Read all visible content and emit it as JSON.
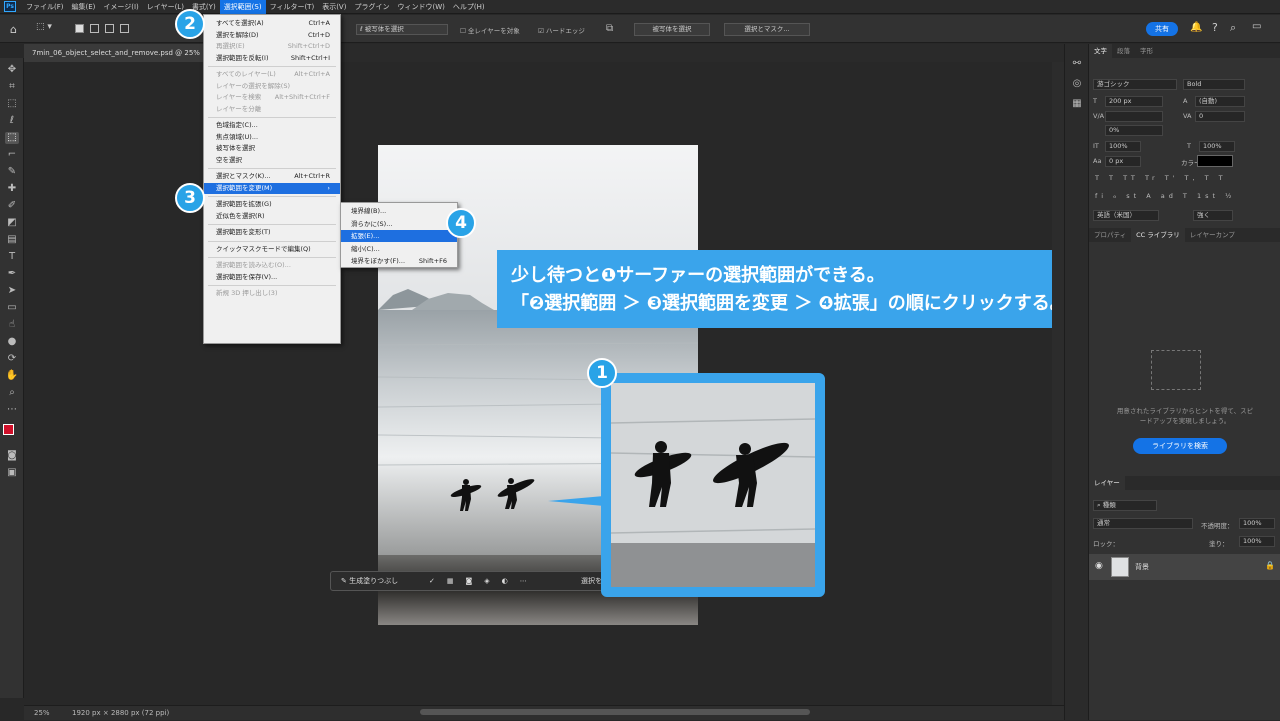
{
  "app": {
    "logo": "Ps"
  },
  "menubar": [
    {
      "label": "ファイル(F)"
    },
    {
      "label": "編集(E)"
    },
    {
      "label": "イメージ(I)"
    },
    {
      "label": "レイヤー(L)"
    },
    {
      "label": "書式(Y)"
    },
    {
      "label": "選択範囲(S)",
      "active": true
    },
    {
      "label": "フィルター(T)"
    },
    {
      "label": "表示(V)"
    },
    {
      "label": "プラグイン"
    },
    {
      "label": "ウィンドウ(W)"
    },
    {
      "label": "ヘルプ(H)"
    }
  ],
  "options": {
    "subject_tool": "被写体を選択",
    "sample_all": "全レイヤーを対象",
    "hard_edge": "ハードエッジ",
    "select_subject": "被写体を選択",
    "select_mask": "選択とマスク...",
    "share": "共有"
  },
  "document": {
    "tab_title": "7min_06_object_select_and_remove.psd @ 25%",
    "zoom": "25%",
    "info": "1920 px × 2880 px (72 ppi)"
  },
  "select_menu": [
    {
      "label": "すべてを選択(A)",
      "shortcut": "Ctrl+A"
    },
    {
      "label": "選択を解除(D)",
      "shortcut": "Ctrl+D"
    },
    {
      "label": "再選択(E)",
      "shortcut": "Shift+Ctrl+D",
      "disabled": true
    },
    {
      "label": "選択範囲を反転(I)",
      "shortcut": "Shift+Ctrl+I"
    },
    {
      "sep": true
    },
    {
      "label": "すべてのレイヤー(L)",
      "shortcut": "Alt+Ctrl+A",
      "disabled": true
    },
    {
      "label": "レイヤーの選択を解除(S)",
      "shortcut": "",
      "disabled": true
    },
    {
      "label": "レイヤーを検索",
      "shortcut": "Alt+Shift+Ctrl+F",
      "disabled": true
    },
    {
      "label": "レイヤーを分離",
      "shortcut": "",
      "disabled": true
    },
    {
      "sep": true
    },
    {
      "label": "色域指定(C)...",
      "shortcut": ""
    },
    {
      "label": "焦点領域(U)...",
      "shortcut": ""
    },
    {
      "label": "被写体を選択",
      "shortcut": ""
    },
    {
      "label": "空を選択",
      "shortcut": ""
    },
    {
      "sep": true
    },
    {
      "label": "選択とマスク(K)...",
      "shortcut": "Alt+Ctrl+R"
    },
    {
      "label": "選択範囲を変更(M)",
      "shortcut": "",
      "highlight": true,
      "submenu": true
    },
    {
      "sep": true
    },
    {
      "label": "選択範囲を拡張(G)",
      "shortcut": ""
    },
    {
      "label": "近似色を選択(R)",
      "shortcut": ""
    },
    {
      "sep": true
    },
    {
      "label": "選択範囲を変形(T)",
      "shortcut": ""
    },
    {
      "sep": true
    },
    {
      "label": "クイックマスクモードで編集(Q)",
      "shortcut": ""
    },
    {
      "sep": true
    },
    {
      "label": "選択範囲を読み込む(O)...",
      "shortcut": "",
      "disabled": true
    },
    {
      "label": "選択範囲を保存(V)...",
      "shortcut": ""
    },
    {
      "sep": true
    },
    {
      "label": "新規 3D 押し出し(3)",
      "shortcut": "",
      "disabled": true
    }
  ],
  "modify_submenu": [
    {
      "label": "境界線(B)...",
      "shortcut": ""
    },
    {
      "label": "滑らかに(S)...",
      "shortcut": ""
    },
    {
      "label": "拡張(E)...",
      "shortcut": "",
      "highlight": true
    },
    {
      "label": "縮小(C)...",
      "shortcut": ""
    },
    {
      "label": "境界をぼかす(F)...",
      "shortcut": "Shift+F6"
    }
  ],
  "callout": {
    "line1": "少し待つと❶サーファーの選択範囲ができる。",
    "line2": "「❷選択範囲 ＞ ❸選択範囲を変更 ＞ ❹拡張」の順にクリックする。"
  },
  "badges": {
    "one": "1",
    "two": "2",
    "three": "3",
    "four": "4"
  },
  "contextbar": {
    "generate": "生成塗りつぶし",
    "select": "選択を"
  },
  "char_panel": {
    "tabs": [
      "文字",
      "段落",
      "字形"
    ],
    "font": "游ゴシック",
    "style": "Bold",
    "size": "200 px",
    "leading": "(自動)",
    "tracking": "0",
    "kerning": "",
    "tsume": "0%",
    "v_scale": "100%",
    "h_scale": "100%",
    "baseline": "0 px",
    "color_label": "カラー：",
    "language": "英語（米国）",
    "aa": "強く"
  },
  "lib_panel": {
    "tabs": [
      "プロパティ",
      "CC ライブラリ",
      "レイヤーカンプ"
    ],
    "hint": "用意されたライブラリからヒントを得て、スピードアップを実現しましょう。",
    "button": "ライブラリを検索"
  },
  "layers_panel": {
    "tab": "レイヤー",
    "search": "種類",
    "blend": "通常",
    "opacity_label": "不透明度：",
    "opacity": "100%",
    "lock_label": "ロック：",
    "fill_label": "塗り：",
    "fill": "100%",
    "layer_name": "背景"
  },
  "colors": {
    "accent": "#3aa4eb",
    "menu_highlight": "#1e6fe0",
    "fg_swatch": "#d0102a"
  }
}
